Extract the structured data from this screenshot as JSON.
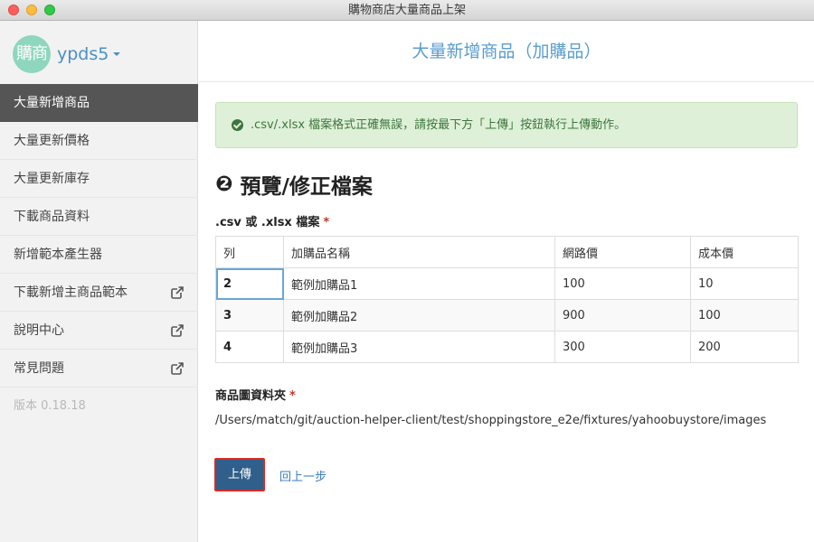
{
  "window": {
    "title": "購物商店大量商品上架"
  },
  "sidebar": {
    "logo_text": "購商",
    "account_name": "ypds5",
    "items": [
      {
        "label": "大量新增商品",
        "external": false
      },
      {
        "label": "大量更新價格",
        "external": false
      },
      {
        "label": "大量更新庫存",
        "external": false
      },
      {
        "label": "下載商品資料",
        "external": false
      },
      {
        "label": "新增範本產生器",
        "external": false
      },
      {
        "label": "下載新增主商品範本",
        "external": true
      },
      {
        "label": "說明中心",
        "external": true
      },
      {
        "label": "常見問題",
        "external": true
      }
    ],
    "active_index": 0,
    "version": "版本 0.18.18"
  },
  "main": {
    "header_title": "大量新增商品（加購品）",
    "alert_text": ".csv/.xlsx 檔案格式正確無誤，請按最下方「上傳」按鈕執行上傳動作。",
    "step_number": "❷",
    "step_title": "預覽/修正檔案",
    "file_label": ".csv 或 .xlsx 檔案",
    "required_mark": "*",
    "table": {
      "headers": [
        "列",
        "加購品名稱",
        "網路價",
        "成本價"
      ],
      "rows": [
        [
          "2",
          "範例加購品1",
          "100",
          "10"
        ],
        [
          "3",
          "範例加購品2",
          "900",
          "100"
        ],
        [
          "4",
          "範例加購品3",
          "300",
          "200"
        ]
      ]
    },
    "image_folder_label": "商品圖資料夾",
    "image_folder_path": "/Users/match/git/auction-helper-client/test/shoppingstore_e2e/fixtures/yahoobuystore/images",
    "upload_button": "上傳",
    "back_link": "回上一步"
  },
  "colors": {
    "accent": "#5b9ccc",
    "sidebar_active": "#555555",
    "success_bg": "#dff0d8",
    "success_text": "#3c763d",
    "button_primary": "#2f5f8a",
    "required": "#c0392b"
  },
  "icons": {
    "external_link": "external-link-icon",
    "success": "check-circle-icon"
  }
}
